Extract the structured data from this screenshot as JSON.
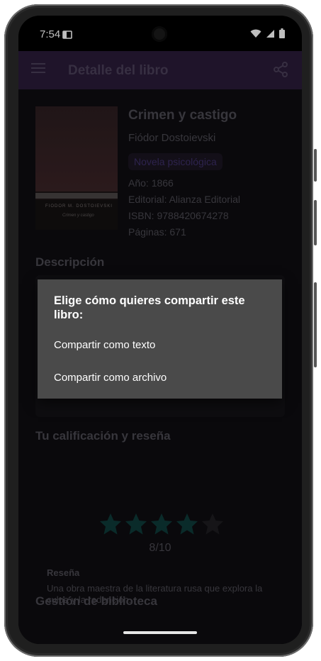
{
  "status_bar": {
    "time": "7:54",
    "icons": [
      "sim-card-icon",
      "wifi-icon",
      "signal-icon",
      "battery-icon"
    ]
  },
  "app_bar": {
    "title": "Detalle del libro",
    "menu_icon": "hamburger-menu-icon",
    "share_icon": "share-icon",
    "color": "#2a1b38"
  },
  "book": {
    "title": "Crimen y castigo",
    "author": "Fiódor Dostoievski",
    "genre": "Novela psicológica",
    "year": "Año: 1866",
    "publisher": "Editorial: Alianza Editorial",
    "isbn": "ISBN: 9788420674278",
    "pages": "Páginas: 671",
    "cover": {
      "author_text": "FIODOR M. DOSTOIEVSKI",
      "title_text": "Crimen y castigo"
    }
  },
  "sections": {
    "description": "Descripción",
    "rating": "Tu calificación y reseña",
    "library": "Gestión de biblioteca"
  },
  "rating": {
    "filled_stars": 4,
    "total_stars": 5,
    "value_text": "8/10",
    "star_color": "#0e3a38"
  },
  "review": {
    "label": "Reseña",
    "text": "Una obra maestra de la literatura rusa que explora la culpa y la redención."
  },
  "dialog": {
    "title": "Elige cómo quieres compartir este libro:",
    "options": [
      "Compartir como texto",
      "Compartir como archivo"
    ]
  }
}
